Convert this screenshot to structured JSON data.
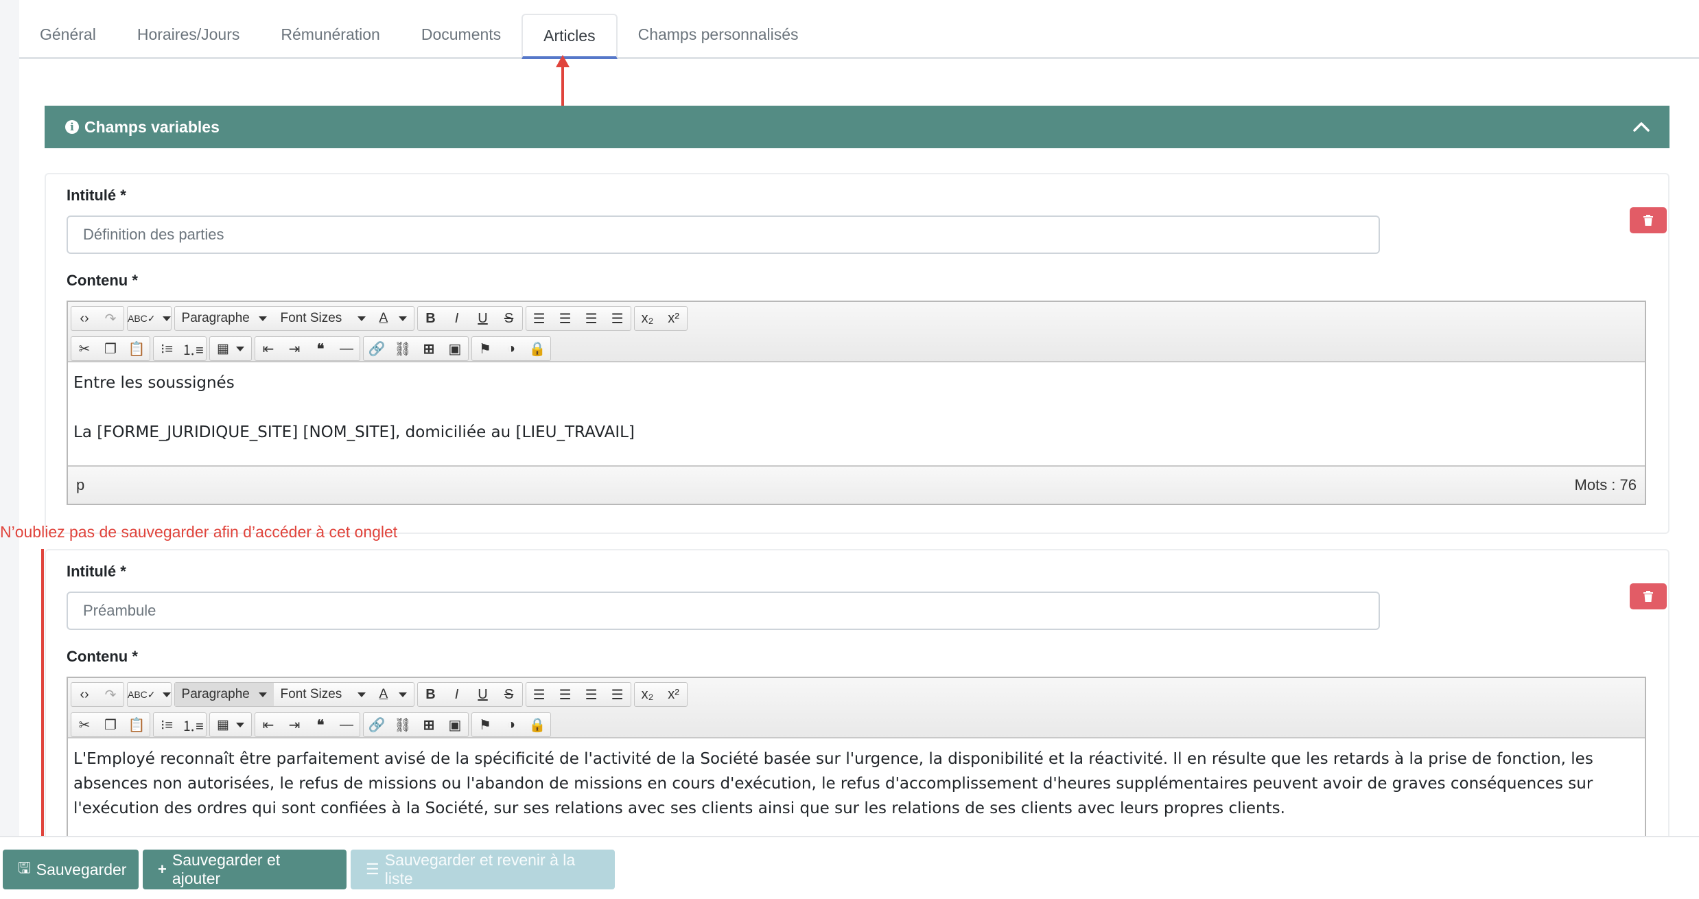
{
  "tabs": [
    {
      "label": "Général"
    },
    {
      "label": "Horaires/Jours"
    },
    {
      "label": "Rémunération"
    },
    {
      "label": "Documents"
    },
    {
      "label": "Articles",
      "active": true
    },
    {
      "label": "Champs personnalisés"
    }
  ],
  "section": {
    "title": "Champs variables"
  },
  "labels": {
    "title": "Intitulé *",
    "content": "Contenu *"
  },
  "toolbar": {
    "format_select": "Paragraphe",
    "size_select": "Font Sizes"
  },
  "articles": [
    {
      "title_value": "Définition des parties",
      "paragraphs": [
        "Entre les soussignés",
        "",
        "La [FORME_JURIDIQUE_SITE] [NOM_SITE], domiciliée au [LIEU_TRAVAIL]"
      ],
      "status_path": "p",
      "word_count": "Mots : 76"
    },
    {
      "title_value": "Préambule",
      "paragraphs": [
        "L'Employé reconnaît être parfaitement avisé de la spécificité de l'activité de la Société basée sur l'urgence, la disponibilité et la réactivité. Il en résulte que les retards à la prise de fonction, les absences non autorisées, le refus de missions ou l'abandon de missions en cours d'exécution, le refus d'accomplissement d'heures supplémentaires peuvent avoir de graves conséquences sur l'exécution des ordres qui sont confiées à la Société, sur ses relations avec ses clients ainsi que sur les relations de ses clients avec leurs propres clients."
      ]
    }
  ],
  "annotation": {
    "note": "N’oubliez pas de sauvegarder afin d’accéder à cet onglet"
  },
  "footer": {
    "save": "Sauvegarder",
    "save_add": "Sauvegarder et ajouter",
    "save_back": "Sauvegarder et revenir à la liste"
  },
  "colors": {
    "accent": "#548c84",
    "danger": "#e25c66",
    "annotation": "#e0443c",
    "tab_active": "#5678c9"
  }
}
